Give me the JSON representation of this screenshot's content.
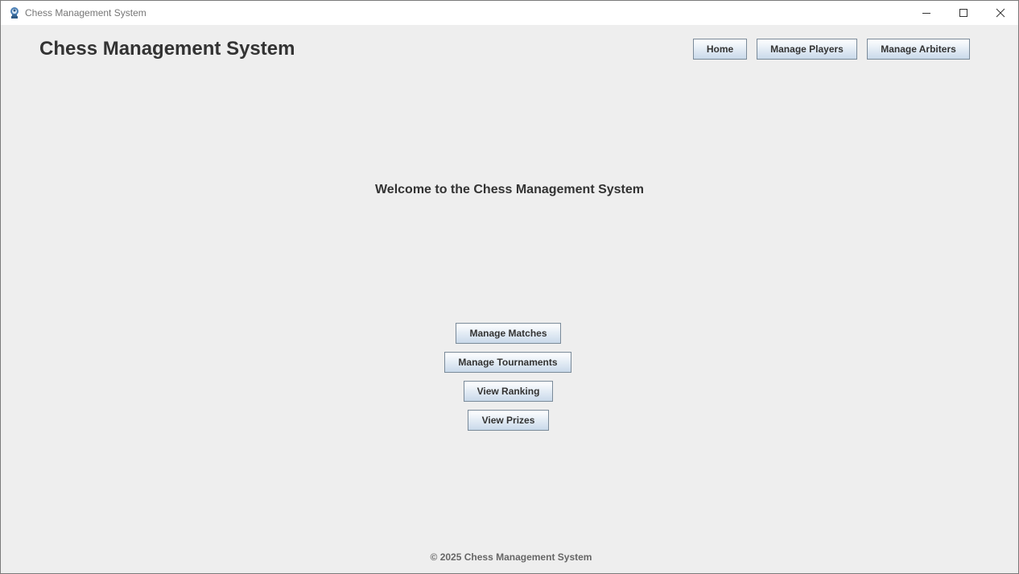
{
  "window": {
    "title": "Chess Management System",
    "icon": "chess-app-icon",
    "controls": {
      "minimize": "minimize-icon",
      "maximize": "maximize-icon",
      "close": "close-icon"
    }
  },
  "header": {
    "title": "Chess Management System",
    "nav": {
      "home": "Home",
      "players": "Manage Players",
      "arbiters": "Manage Arbiters"
    }
  },
  "main": {
    "welcome": "Welcome to the Chess Management System",
    "actions": {
      "matches": "Manage Matches",
      "tournaments": "Manage Tournaments",
      "ranking": "View Ranking",
      "prizes": "View Prizes"
    }
  },
  "footer": {
    "text": "© 2025 Chess Management System"
  },
  "colors": {
    "background": "#eeeeee",
    "text": "#333333",
    "footer_text": "#666666",
    "button_border": "#7a8a99"
  }
}
